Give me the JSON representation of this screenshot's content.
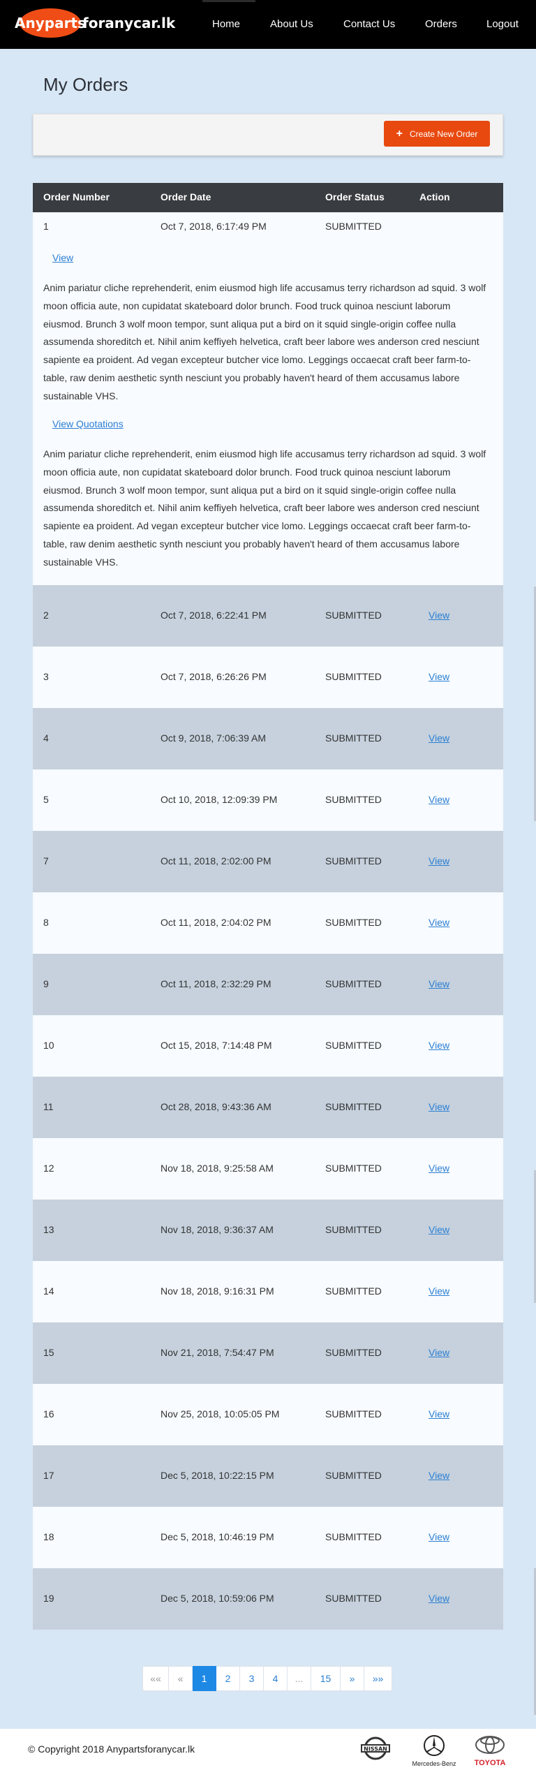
{
  "brand": {
    "logo_highlight": "Anyparts",
    "logo_rest": "foranycar.lk",
    "accent_color": "#f04d16"
  },
  "nav": {
    "items": [
      {
        "label": "Home"
      },
      {
        "label": "About Us"
      },
      {
        "label": "Contact Us"
      },
      {
        "label": "Orders"
      },
      {
        "label": "Logout"
      }
    ]
  },
  "page": {
    "title": "My Orders"
  },
  "toolbar": {
    "create_label": "Create New Order",
    "create_icon": "plus-icon",
    "button_color": "#e8490f"
  },
  "table": {
    "headers": [
      "Order Number",
      "Order Date",
      "Order Status",
      "Action"
    ],
    "expanded": {
      "number": "1",
      "date": "Oct 7, 2018, 6:17:49 PM",
      "status": "SUBMITTED",
      "view_label": "View",
      "description": "Anim pariatur cliche reprehenderit, enim eiusmod high life accusamus terry richardson ad squid. 3 wolf moon officia aute, non cupidatat skateboard dolor brunch. Food truck quinoa nesciunt laborum eiusmod. Brunch 3 wolf moon tempor, sunt aliqua put a bird on it squid single-origin coffee nulla assumenda shoreditch et. Nihil anim keffiyeh helvetica, craft beer labore wes anderson cred nesciunt sapiente ea proident. Ad vegan excepteur butcher vice lomo. Leggings occaecat craft beer farm-to-table, raw denim aesthetic synth nesciunt you probably haven't heard of them accusamus labore sustainable VHS.",
      "quotations_label": "View Quotations",
      "quotations_text": "Anim pariatur cliche reprehenderit, enim eiusmod high life accusamus terry richardson ad squid. 3 wolf moon officia aute, non cupidatat skateboard dolor brunch. Food truck quinoa nesciunt laborum eiusmod. Brunch 3 wolf moon tempor, sunt aliqua put a bird on it squid single-origin coffee nulla assumenda shoreditch et. Nihil anim keffiyeh helvetica, craft beer labore wes anderson cred nesciunt sapiente ea proident. Ad vegan excepteur butcher vice lomo. Leggings occaecat craft beer farm-to-table, raw denim aesthetic synth nesciunt you probably haven't heard of them accusamus labore sustainable VHS."
    },
    "rows": [
      {
        "number": "2",
        "date": "Oct 7, 2018, 6:22:41 PM",
        "status": "SUBMITTED",
        "action": "View"
      },
      {
        "number": "3",
        "date": "Oct 7, 2018, 6:26:26 PM",
        "status": "SUBMITTED",
        "action": "View"
      },
      {
        "number": "4",
        "date": "Oct 9, 2018, 7:06:39 AM",
        "status": "SUBMITTED",
        "action": "View"
      },
      {
        "number": "5",
        "date": "Oct 10, 2018, 12:09:39 PM",
        "status": "SUBMITTED",
        "action": "View"
      },
      {
        "number": "7",
        "date": "Oct 11, 2018, 2:02:00 PM",
        "status": "SUBMITTED",
        "action": "View"
      },
      {
        "number": "8",
        "date": "Oct 11, 2018, 2:04:02 PM",
        "status": "SUBMITTED",
        "action": "View"
      },
      {
        "number": "9",
        "date": "Oct 11, 2018, 2:32:29 PM",
        "status": "SUBMITTED",
        "action": "View"
      },
      {
        "number": "10",
        "date": "Oct 15, 2018, 7:14:48 PM",
        "status": "SUBMITTED",
        "action": "View"
      },
      {
        "number": "11",
        "date": "Oct 28, 2018, 9:43:36 AM",
        "status": "SUBMITTED",
        "action": "View"
      },
      {
        "number": "12",
        "date": "Nov 18, 2018, 9:25:58 AM",
        "status": "SUBMITTED",
        "action": "View"
      },
      {
        "number": "13",
        "date": "Nov 18, 2018, 9:36:37 AM",
        "status": "SUBMITTED",
        "action": "View"
      },
      {
        "number": "14",
        "date": "Nov 18, 2018, 9:16:31 PM",
        "status": "SUBMITTED",
        "action": "View"
      },
      {
        "number": "15",
        "date": "Nov 21, 2018, 7:54:47 PM",
        "status": "SUBMITTED",
        "action": "View"
      },
      {
        "number": "16",
        "date": "Nov 25, 2018, 10:05:05 PM",
        "status": "SUBMITTED",
        "action": "View"
      },
      {
        "number": "17",
        "date": "Dec 5, 2018, 10:22:15 PM",
        "status": "SUBMITTED",
        "action": "View"
      },
      {
        "number": "18",
        "date": "Dec 5, 2018, 10:46:19 PM",
        "status": "SUBMITTED",
        "action": "View"
      },
      {
        "number": "19",
        "date": "Dec 5, 2018, 10:59:06 PM",
        "status": "SUBMITTED",
        "action": "View"
      }
    ]
  },
  "pagination": {
    "items": [
      {
        "label": "««",
        "state": "muted"
      },
      {
        "label": "«",
        "state": "muted"
      },
      {
        "label": "1",
        "state": "active"
      },
      {
        "label": "2",
        "state": "normal"
      },
      {
        "label": "3",
        "state": "normal"
      },
      {
        "label": "4",
        "state": "normal"
      },
      {
        "label": "...",
        "state": "muted"
      },
      {
        "label": "15",
        "state": "normal"
      },
      {
        "label": "»",
        "state": "normal"
      },
      {
        "label": "»»",
        "state": "normal"
      }
    ],
    "active_color": "#1e88e5"
  },
  "footer": {
    "copyright": "© Copyright 2018 Anypartsforanycar.lk",
    "brands": [
      {
        "name": "nissan",
        "label": "NISSAN",
        "icon": "nissan-logo-icon"
      },
      {
        "name": "mercedes",
        "label": "Mercedes-Benz",
        "icon": "mercedes-star-icon"
      },
      {
        "name": "toyota",
        "label": "TOYOTA",
        "icon": "toyota-ellipse-icon",
        "color": "#d4202a"
      }
    ]
  }
}
